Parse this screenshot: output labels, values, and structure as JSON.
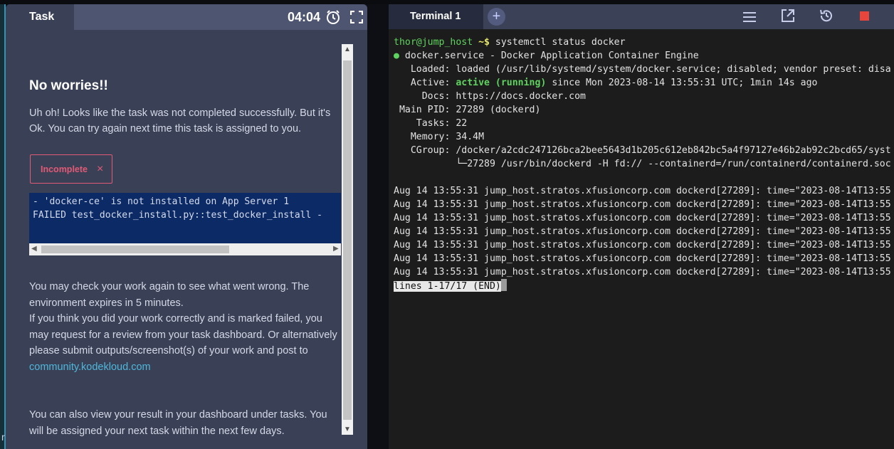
{
  "task": {
    "tab_label": "Task",
    "timer": "04:04",
    "title": "No worries!!",
    "intro": "Uh oh! Looks like the task was not completed successfully. But it's Ok. You can try again next time this task is assigned to you.",
    "status_label": "Incomplete",
    "status_close": "×",
    "error_lines": [
      "- 'docker-ce' is not installed on App Server 1",
      "FAILED test_docker_install.py::test_docker_install - "
    ],
    "followup_line1": "You may check your work again to see what went wrong. The environment expires in 5 minutes.",
    "followup_line2": "If you think you did your work correctly and is marked failed, you may request for a review from your task dashboard. Or alternatively please submit outputs/screenshot(s) of your work and post to ",
    "link": "community.kodekloud.com",
    "final": "You can also view your result in your dashboard under tasks. You will be assigned your next task within the next few days."
  },
  "terminal": {
    "tab_label": "Terminal 1",
    "plus": "+",
    "prompt_user": "thor@jump_host",
    "prompt_path": " ~$",
    "command": " systemctl status docker",
    "service_dot": "●",
    "service_line": " docker.service - Docker Application Container Engine",
    "loaded_line": "   Loaded: loaded (/usr/lib/systemd/system/docker.service; disabled; vendor preset: disa",
    "active_label": "   Active: ",
    "active_state": "active (running)",
    "active_rest": " since Mon 2023-08-14 13:55:31 UTC; 1min 14s ago",
    "docs_line": "     Docs: https://docs.docker.com",
    "pid_line": " Main PID: 27289 (dockerd)",
    "tasks_line": "    Tasks: 22",
    "memory_line": "   Memory: 34.4M",
    "cgroup_line": "   CGroup: /docker/a2cdc247126bca2bee5643d1b205c612eb842bc5a4f97127e46b2ab92c2bcd65/syst",
    "cgroup_sub": "           └─27289 /usr/bin/dockerd -H fd:// --containerd=/run/containerd/containerd.soc",
    "log_line": "Aug 14 13:55:31 jump_host.stratos.xfusioncorp.com dockerd[27289]: time=\"2023-08-14T13:55",
    "pager": "lines 1-17/17 (END)"
  }
}
